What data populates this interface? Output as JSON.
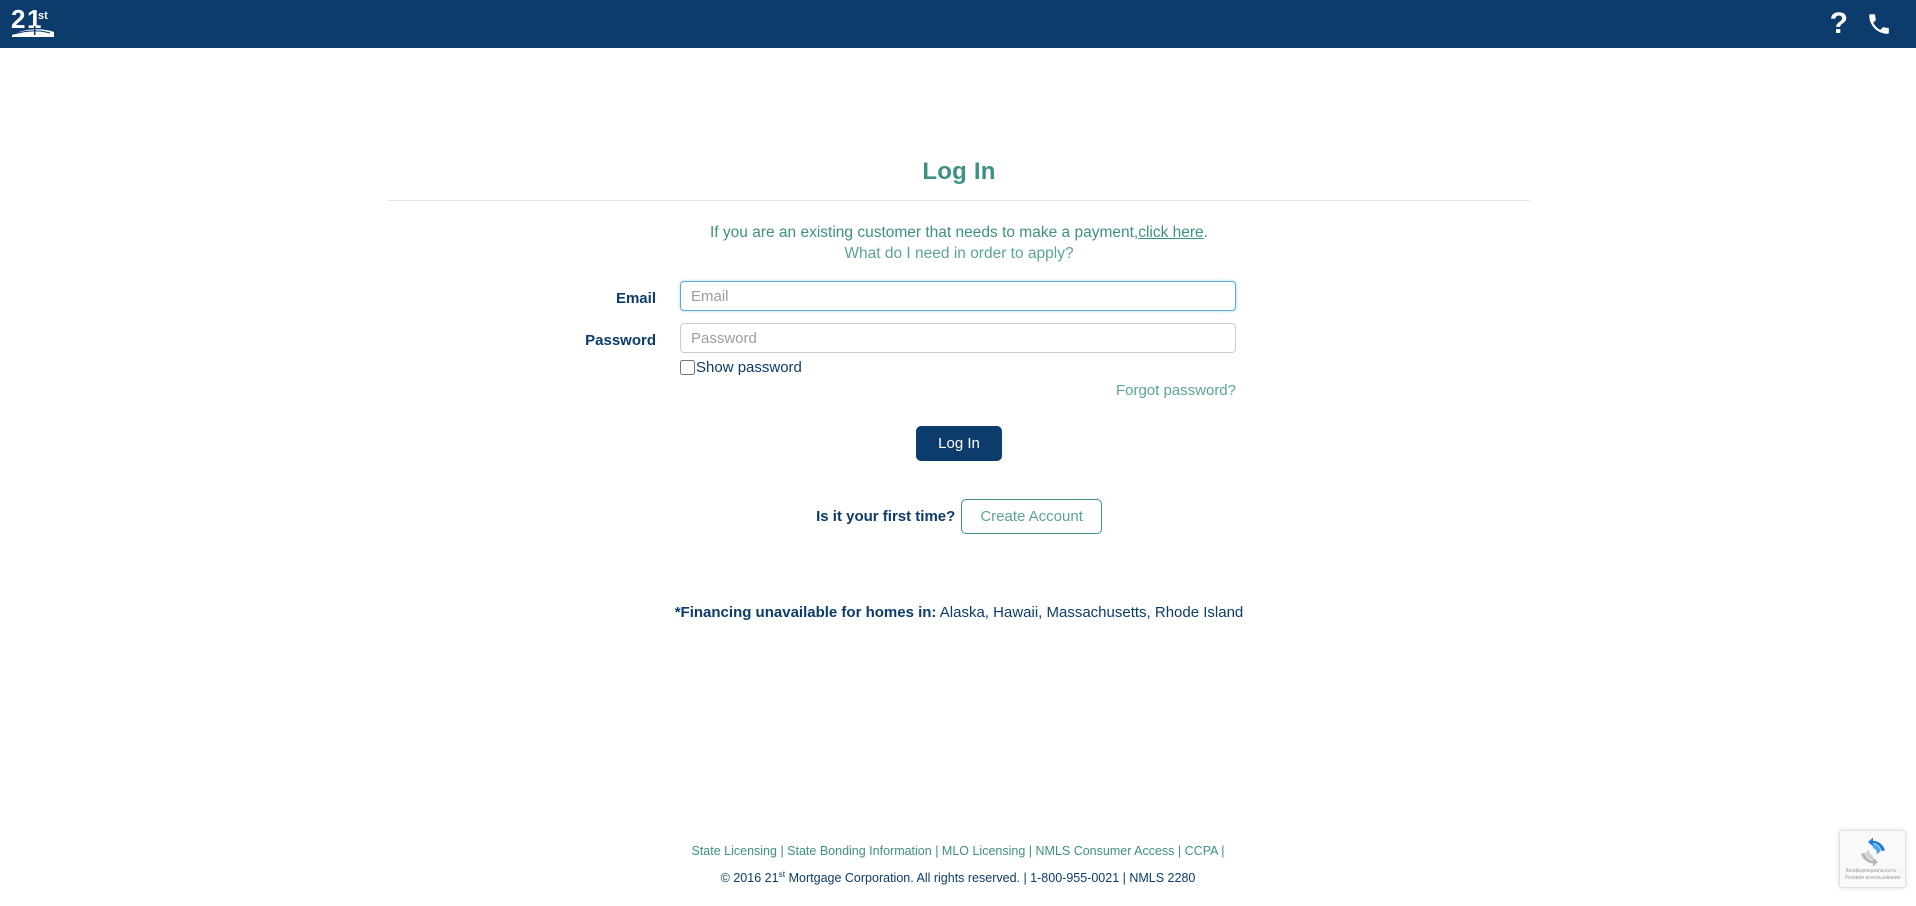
{
  "header": {
    "logo_text": "21st",
    "logo_name": "21st-mortgage-logo",
    "help_icon": "question-mark-icon",
    "help_label": "?",
    "phone_icon": "phone-icon"
  },
  "main": {
    "title": "Log In",
    "intro_prefix": "If you are an existing customer that needs to make a payment,",
    "intro_link": "click here",
    "intro_suffix": ".",
    "apply_link": "What do I need in order to apply?",
    "form": {
      "email_label": "Email",
      "email_placeholder": "Email",
      "email_value": "",
      "password_label": "Password",
      "password_placeholder": "Password",
      "password_value": "",
      "show_password_label": "Show password",
      "show_password_checked": false,
      "forgot_link": "Forgot password?",
      "login_button": "Log In"
    },
    "first_time_text": "Is it your first time?",
    "create_account_button": "Create Account",
    "financing_note_bold": "*Financing unavailable for homes in:",
    "financing_note_states": "Alaska, Hawaii, Massachusetts, Rhode Island"
  },
  "footer": {
    "links": [
      "State Licensing",
      "State Bonding Information",
      "MLO Licensing",
      "NMLS Consumer Access",
      "CCPA"
    ],
    "separator": " | ",
    "trailing_separator": " |",
    "copyright_pre": "© 2016 21",
    "copyright_sup": "st",
    "copyright_post": " Mortgage Corporation. All rights reserved. | 1-800-955-0021 | NMLS 2280"
  },
  "recaptcha": {
    "icon": "recaptcha-icon",
    "text": "Конфиденциальность - Условия использования"
  },
  "colors": {
    "navy": "#0b3c6b",
    "teal": "#3d9183",
    "teal_light": "#5aa496",
    "focus_blue": "#55a8e0"
  }
}
